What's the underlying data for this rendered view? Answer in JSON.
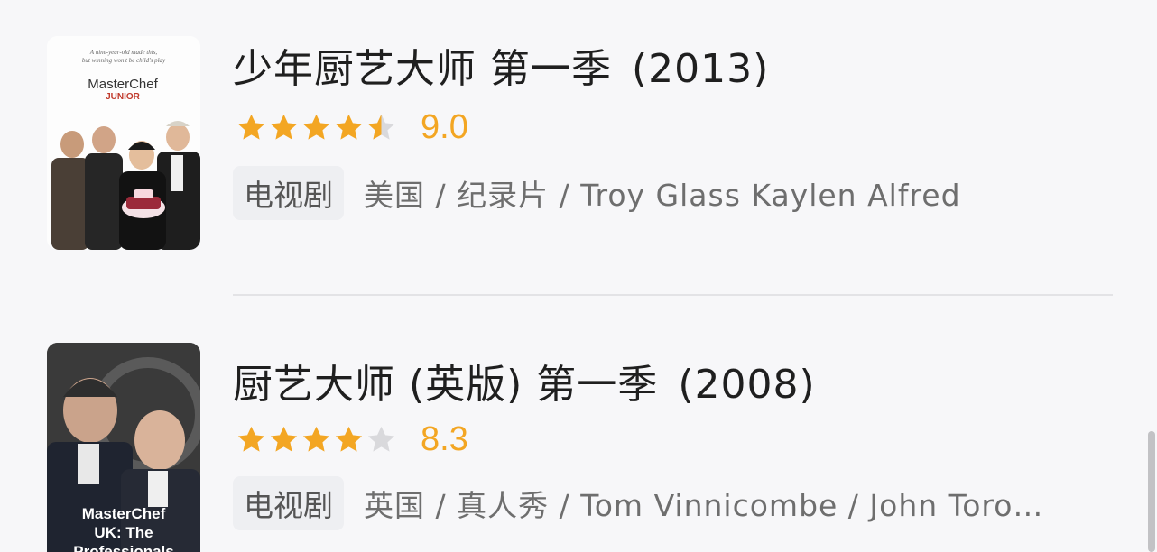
{
  "items": [
    {
      "title": "少年厨艺大师 第一季",
      "year": "(2013)",
      "rating": 4.5,
      "score": "9.0",
      "tag": "电视剧",
      "meta": "美国 / 纪录片 / Troy Glass Kaylen Alfred",
      "poster": {
        "tagline_1": "A nine-year-old made this,",
        "tagline_2": "but winning won't be child's play",
        "brand": "MasterChef",
        "sub": "JUNIOR"
      }
    },
    {
      "title": "厨艺大师 (英版) 第一季",
      "year": "(2008)",
      "rating": 4,
      "score": "8.3",
      "tag": "电视剧",
      "meta": "英国 / 真人秀 / Tom Vinnicombe / John Toro…",
      "poster": {
        "brand_line1": "MasterChef",
        "brand_line2": "UK: The",
        "brand_line3": "Professionals"
      }
    }
  ],
  "colors": {
    "star_filled": "#f3a623",
    "star_empty": "#d9d9dc",
    "score": "#f3a623"
  }
}
